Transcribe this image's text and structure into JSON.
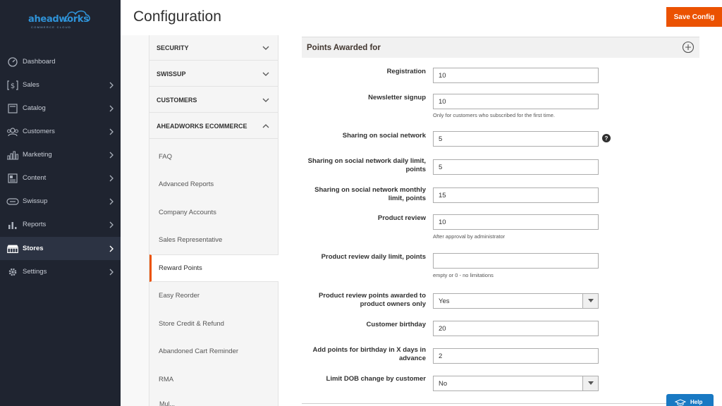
{
  "brand": {
    "logo_text": "aheadworks",
    "logo_sub": "COMMERCE CLOUD"
  },
  "sidebar": {
    "items": [
      {
        "label": "Dashboard",
        "icon": "dashboard-icon"
      },
      {
        "label": "Sales",
        "icon": "dollar-icon"
      },
      {
        "label": "Catalog",
        "icon": "catalog-icon"
      },
      {
        "label": "Customers",
        "icon": "customers-icon"
      },
      {
        "label": "Marketing",
        "icon": "marketing-icon"
      },
      {
        "label": "Content",
        "icon": "content-icon"
      },
      {
        "label": "Swissup",
        "icon": "swissup-icon"
      },
      {
        "label": "Reports",
        "icon": "reports-icon"
      },
      {
        "label": "Stores",
        "icon": "stores-icon",
        "active": true
      },
      {
        "label": "Settings",
        "icon": "gear-icon"
      }
    ]
  },
  "header": {
    "title": "Configuration",
    "save_label": "Save Config"
  },
  "config_menu": {
    "sections": [
      {
        "label": "SECURITY"
      },
      {
        "label": "SWISSUP"
      },
      {
        "label": "CUSTOMERS"
      },
      {
        "label": "AHEADWORKS ECOMMERCE"
      }
    ],
    "items": [
      {
        "label": "FAQ"
      },
      {
        "label": "Advanced Reports"
      },
      {
        "label": "Company Accounts"
      },
      {
        "label": "Sales Representative"
      },
      {
        "label": "Reward Points",
        "active": true
      },
      {
        "label": "Easy Reorder"
      },
      {
        "label": "Store Credit & Refund"
      },
      {
        "label": "Abandoned Cart Reminder"
      },
      {
        "label": "RMA"
      },
      {
        "label": "Mul..."
      }
    ]
  },
  "group": {
    "title": "Points Awarded for"
  },
  "fields": {
    "registration": {
      "label": "Registration",
      "value": "10"
    },
    "newsletter": {
      "label": "Newsletter signup",
      "value": "10",
      "note": "Only for customers who subscribed for the first time."
    },
    "social": {
      "label": "Sharing on social network",
      "value": "5",
      "help": "?"
    },
    "social_daily": {
      "label_line1": "Sharing on social network daily limit,",
      "label_line2": "points",
      "value": "5"
    },
    "social_monthly": {
      "label_line1": "Sharing on social network monthly",
      "label_line2": "limit, points",
      "value": "15"
    },
    "product_review": {
      "label": "Product review",
      "value": "10",
      "note": "After approval by administrator"
    },
    "review_daily": {
      "label": "Product review daily limit, points",
      "value": "",
      "note": "empty or 0 - no limitations"
    },
    "review_owners": {
      "label_line1": "Product review points awarded to",
      "label_line2": "product owners only",
      "value": "Yes"
    },
    "birthday": {
      "label": "Customer birthday",
      "value": "20"
    },
    "birthday_advance": {
      "label_line1": "Add points for birthday in X days in",
      "label_line2": "advance",
      "value": "2"
    },
    "dob_limit": {
      "label": "Limit DOB change by customer",
      "value": "No"
    }
  },
  "help": {
    "label": "Help"
  },
  "colors": {
    "accent": "#eb5202",
    "sidebar_bg": "#1f2430",
    "help_blue": "#1979c3"
  }
}
